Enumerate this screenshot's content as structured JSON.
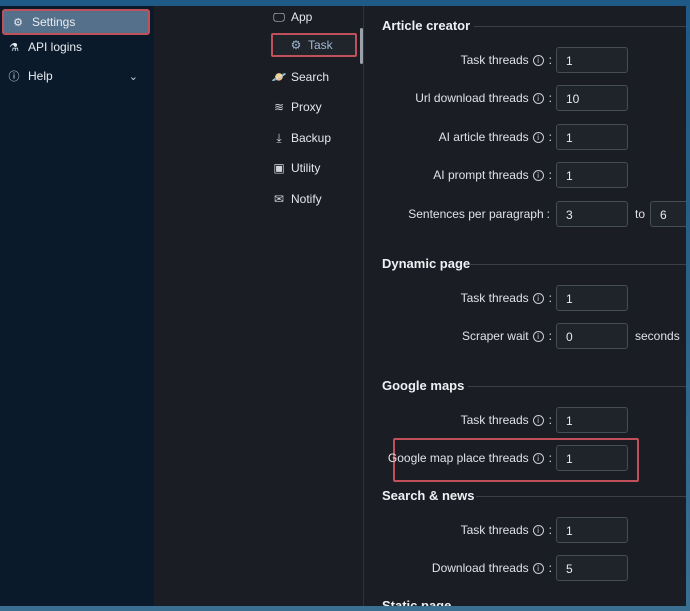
{
  "sidebar": {
    "items": [
      {
        "label": "Settings",
        "icon": "gear-icon"
      },
      {
        "label": "API logins",
        "icon": "flask-icon"
      },
      {
        "label": "Help",
        "icon": "info-icon"
      }
    ]
  },
  "subnav": {
    "items": [
      {
        "label": "App",
        "icon": "monitor-icon"
      },
      {
        "label": "Task",
        "icon": "gear-icon"
      },
      {
        "label": "Search",
        "icon": "planet-icon"
      },
      {
        "label": "Proxy",
        "icon": "wifi-icon"
      },
      {
        "label": "Backup",
        "icon": "download-icon"
      },
      {
        "label": "Utility",
        "icon": "toolbox-icon"
      },
      {
        "label": "Notify",
        "icon": "mail-icon"
      }
    ]
  },
  "sections": {
    "article_creator": {
      "title": "Article creator",
      "task_threads": {
        "label": "Task threads",
        "value": "1"
      },
      "url_download_threads": {
        "label": "Url download threads",
        "value": "10"
      },
      "ai_article_threads": {
        "label": "AI article threads",
        "value": "1"
      },
      "ai_prompt_threads": {
        "label": "AI prompt threads",
        "value": "1"
      },
      "sentences_per_paragraph": {
        "label": "Sentences per paragraph",
        "from": "3",
        "to_label": "to",
        "to": "6"
      }
    },
    "dynamic_page": {
      "title": "Dynamic page",
      "task_threads": {
        "label": "Task threads",
        "value": "1"
      },
      "scraper_wait": {
        "label": "Scraper wait",
        "value": "0",
        "unit": "seconds"
      }
    },
    "google_maps": {
      "title": "Google maps",
      "task_threads": {
        "label": "Task threads",
        "value": "1"
      },
      "place_threads": {
        "label": "Google map place threads",
        "value": "1"
      }
    },
    "search_news": {
      "title": "Search & news",
      "task_threads": {
        "label": "Task threads",
        "value": "1"
      },
      "download_threads": {
        "label": "Download threads",
        "value": "5"
      }
    },
    "static_page": {
      "title": "Static page"
    }
  },
  "colors": {
    "highlight": "#c0515b",
    "active_nav": "#55708b"
  }
}
